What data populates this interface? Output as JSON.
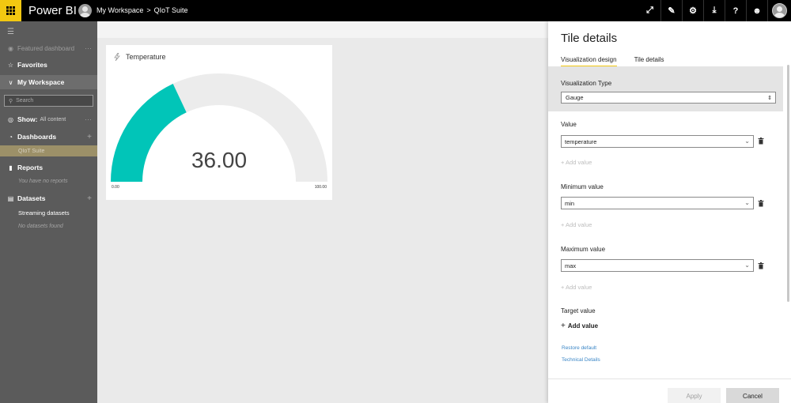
{
  "app": {
    "brand": "Power BI",
    "breadcrumb": [
      "My Workspace",
      "QIoT Suite"
    ],
    "breadcrumb_sep": ">",
    "brand_color": "#f2c811"
  },
  "topbar": {
    "icons": [
      {
        "name": "expand-icon",
        "glyph": "⤢"
      },
      {
        "name": "feedback-icon",
        "glyph": "✎"
      },
      {
        "name": "settings-gear-icon",
        "glyph": "⚙"
      },
      {
        "name": "download-icon",
        "glyph": "⤓"
      },
      {
        "name": "help-icon",
        "glyph": "?"
      },
      {
        "name": "smiley-icon",
        "glyph": "☻"
      }
    ]
  },
  "nav": {
    "featured": "Featured dashboard",
    "featured_more": "···",
    "favorites": "Favorites",
    "workspace": "My Workspace",
    "search_placeholder": "Search",
    "show_label": "Show:",
    "show_value": "All content",
    "show_more": "···",
    "dashboards": "Dashboards",
    "dashboard_item": "QIoT Suite",
    "reports": "Reports",
    "no_reports": "You have no reports",
    "datasets": "Datasets",
    "streaming": "Streaming datasets",
    "no_datasets": "No datasets found",
    "plus": "+"
  },
  "tile": {
    "title": "Temperature",
    "value": "36.00",
    "min_label": "0.00",
    "max_label": "100.00",
    "gauge": {
      "min": 0,
      "max": 100,
      "value": 36
    },
    "fill_color": "#01c5b8",
    "track_color": "#ececec"
  },
  "panel": {
    "title": "Tile details",
    "tabs": [
      "Visualization design",
      "Tile details"
    ],
    "viz_type_label": "Visualization Type",
    "viz_type_value": "Gauge",
    "value_label": "Value",
    "value_field": "temperature",
    "add_value_1": "+ Add value",
    "min_label": "Minimum value",
    "min_field": "min",
    "add_value_2": "+ Add value",
    "max_label": "Maximum value",
    "max_field": "max",
    "add_value_3": "+ Add value",
    "target_label": "Target value",
    "target_add": "Add value",
    "restore_default": "Restore default",
    "technical_details": "Technical Details",
    "apply": "Apply",
    "cancel": "Cancel"
  }
}
